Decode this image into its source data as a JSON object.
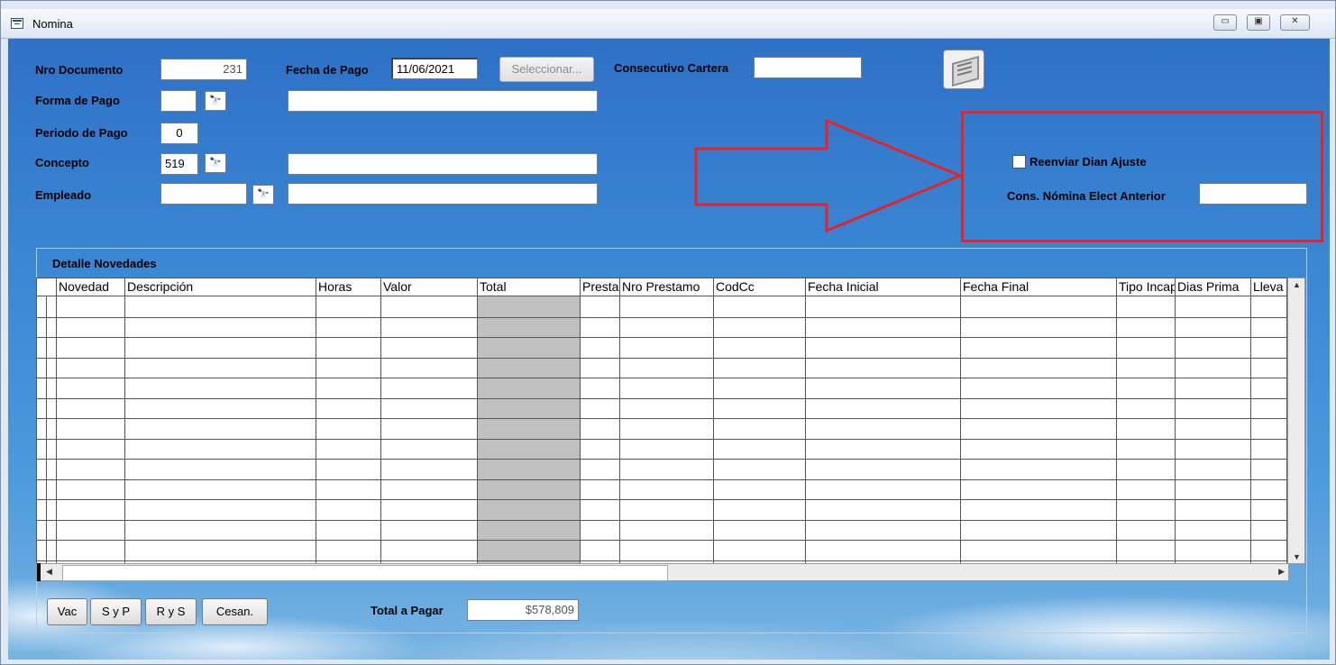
{
  "window": {
    "title": "Nomina"
  },
  "form": {
    "nro_documento_label": "Nro Documento",
    "nro_documento_value": "231",
    "fecha_pago_label": "Fecha de Pago",
    "fecha_pago_value": "11/06/2021",
    "seleccionar_label": "Seleccionar...",
    "consecutivo_label": "Consecutivo Cartera",
    "consecutivo_value": "",
    "forma_pago_label": "Forma de Pago",
    "forma_pago_value": "",
    "forma_pago_desc": "",
    "periodo_pago_label": "Periodo de Pago",
    "periodo_pago_value": "0",
    "concepto_label": "Concepto",
    "concepto_value": "519",
    "concepto_desc": "",
    "empleado_label": "Empleado",
    "empleado_value": "",
    "empleado_desc": ""
  },
  "dian": {
    "reenviar_label": "Reenviar Dian Ajuste",
    "reenviar_checked": false,
    "cons_label": "Cons. Nómina Elect Anterior",
    "cons_value": ""
  },
  "grid": {
    "group_label": "Detalle Novedades",
    "columns": [
      "Novedad",
      "Descripción",
      "Horas",
      "Valor",
      "Total",
      "Prestamo",
      "Nro Prestamo",
      "CodCc",
      "Fecha Inicial",
      "Fecha Final",
      "Tipo Incapacidad",
      "Dias Prima",
      "Lleva"
    ],
    "row_count": 13
  },
  "footer": {
    "btn_vac": "Vac",
    "btn_syp": "S y P",
    "btn_rys": "R y S",
    "btn_cesan": "Cesan.",
    "total_label": "Total a Pagar",
    "total_value": "$578,809"
  },
  "colors": {
    "annotation_red": "#e3242b",
    "background_blue": "#3a86d3"
  }
}
